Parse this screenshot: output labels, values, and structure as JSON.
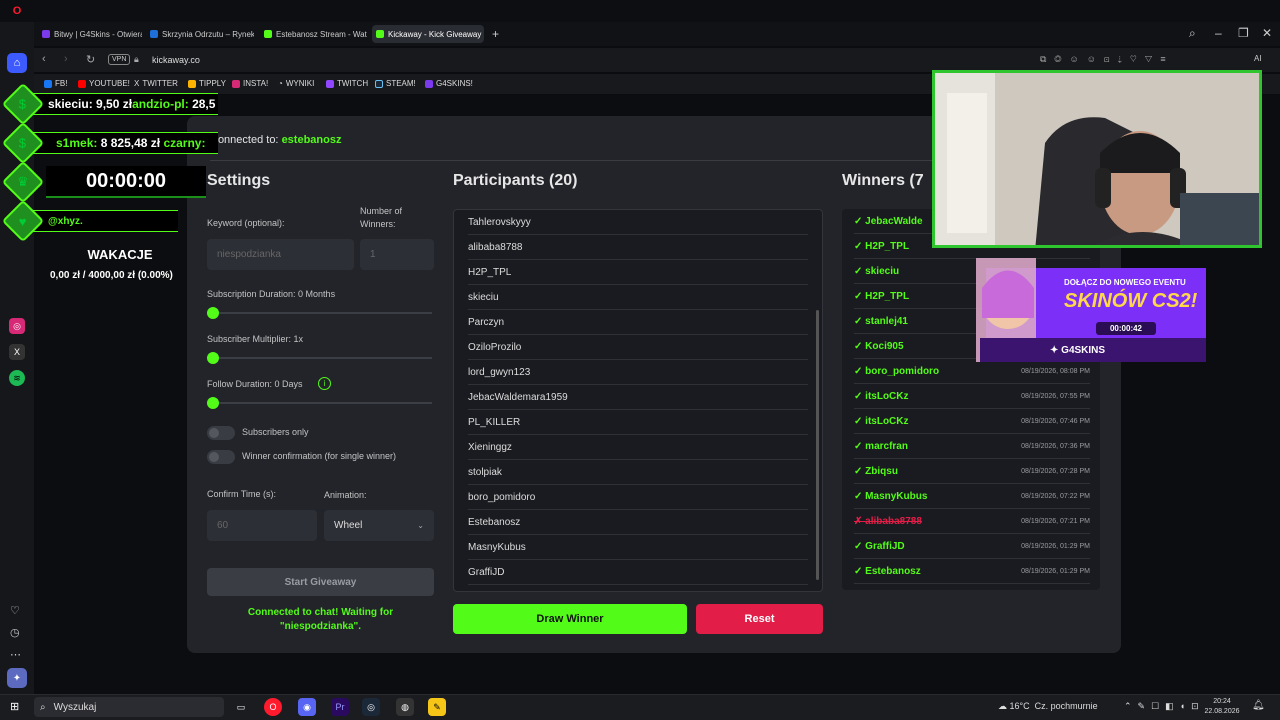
{
  "browser": {
    "tabs": [
      {
        "label": "Bitwy | G4Skins - Otwieraj",
        "color": "#7c3aed"
      },
      {
        "label": "Skrzynia Odrzutu – Rynek",
        "color": "#1e6fd9"
      },
      {
        "label": "Estebanosz Stream - Wat",
        "color": "#53fc18"
      },
      {
        "label": "Kickaway - Kick Giveaway",
        "color": "#53fc18"
      }
    ],
    "new_tab": "+",
    "url": "kickaway.co",
    "vpn": "VPN",
    "bookmarks": [
      "FB!",
      "YOUTUBE!",
      "TWITTER",
      "TIPPLY",
      "INSTA!",
      "WYNIKI",
      "TWITCH",
      "STEAM!",
      "G4SKINS!"
    ]
  },
  "page": {
    "connected_prefix": "Connected to:",
    "channel": "estebanosz",
    "settings_title": "Settings",
    "keyword_label": "Keyword (optional):",
    "keyword_value": "niespodzianka",
    "winners_label": "Number of Winners:",
    "winners_value": "1",
    "sub_duration_label": "Subscription Duration: 0 Months",
    "sub_multiplier_label": "Subscriber Multiplier: 1x",
    "follow_label": "Follow Duration:  0  Days",
    "subs_only_label": "Subscribers only",
    "winner_confirm_label": "Winner confirmation (for single winner)",
    "confirm_time_label": "Confirm Time (s):",
    "confirm_time_value": "60",
    "animation_label": "Animation:",
    "animation_value": "Wheel",
    "start_button": "Start Giveaway",
    "status_text": "Connected to chat! Waiting for \"niespodzianka\".",
    "participants_title": "Participants (20)",
    "participants": [
      "Tahlerovskyyy",
      "alibaba8788",
      "H2P_TPL",
      "skieciu",
      "Parczyn",
      "OziloProzilo",
      "lord_gwyn123",
      "JebacWaldemara1959",
      "PL_KILLER",
      "Xieninggz",
      "stolpiak",
      "boro_pomidoro",
      "Estebanosz",
      "MasnyKubus",
      "GraffiJD"
    ],
    "draw_button": "Draw Winner",
    "reset_button": "Reset",
    "winners_title": "Winners (7",
    "winners": [
      {
        "name": "JebacWalde",
        "date": "",
        "removed": false
      },
      {
        "name": "H2P_TPL",
        "date": "",
        "removed": false
      },
      {
        "name": "skieciu",
        "date": "",
        "removed": false
      },
      {
        "name": "H2P_TPL",
        "date": "",
        "removed": false
      },
      {
        "name": "stanlej41",
        "date": "",
        "removed": false
      },
      {
        "name": "Koci905",
        "date": "",
        "removed": false
      },
      {
        "name": "boro_pomidoro",
        "date": "08/19/2026, 08:08 PM",
        "removed": false
      },
      {
        "name": "itsLoCKz",
        "date": "08/19/2026, 07:55 PM",
        "removed": false
      },
      {
        "name": "itsLoCKz",
        "date": "08/19/2026, 07:46 PM",
        "removed": false
      },
      {
        "name": "marcfran",
        "date": "08/19/2026, 07:36 PM",
        "removed": false
      },
      {
        "name": "Zbiqsu",
        "date": "08/19/2026, 07:28 PM",
        "removed": false
      },
      {
        "name": "MasnyKubus",
        "date": "08/19/2026, 07:22 PM",
        "removed": false
      },
      {
        "name": "alibaba8788",
        "date": "08/19/2026, 07:21 PM",
        "removed": true
      },
      {
        "name": "GraffiJD",
        "date": "08/19/2026, 01:29 PM",
        "removed": false
      },
      {
        "name": "Estebanosz",
        "date": "08/19/2026, 01:29 PM",
        "removed": false
      }
    ]
  },
  "overlay": {
    "row1_a": "skieciu:",
    "row1_b": "9,50 zł",
    "row1_c": "andzio-pl:",
    "row1_d": "28,5",
    "row2_a": "s1mek:",
    "row2_b": "8 825,48 zł",
    "row2_c": "czarny:",
    "timer": "00:00:00",
    "row4": "@xhyz.",
    "goal_title": "WAKACJE",
    "goal_value": "0,00 zł / 4000,00 zł (0.00%)"
  },
  "promo": {
    "line1": "DOŁĄCZ DO NOWEGO EVENTU",
    "line2": "SKINÓW CS2!",
    "timer": "00:00:42",
    "brand": "G4SKINS"
  },
  "taskbar": {
    "search_placeholder": "Wyszukaj",
    "weather_temp": "16°C",
    "weather_desc": "Cz. pochmurnie",
    "time": "20:24",
    "date": "22.08.2026"
  },
  "colors": {
    "accent": "#53fc18",
    "danger": "#e11d48",
    "card": "#22242a"
  }
}
